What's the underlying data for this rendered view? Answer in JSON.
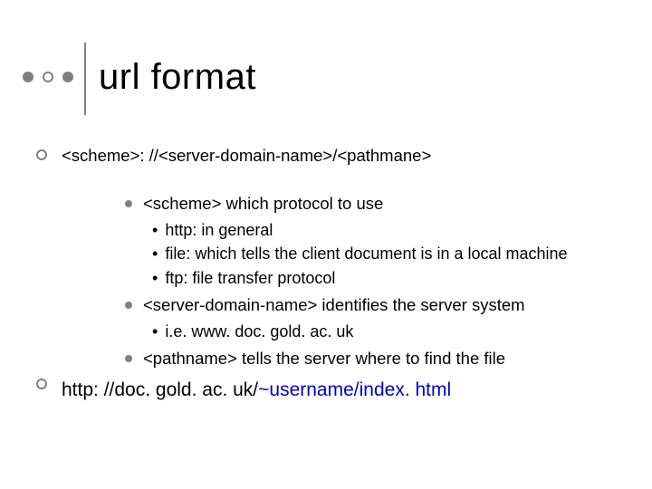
{
  "title": "url format",
  "main_bullet": "<scheme>: //<server-domain-name>/<pathmane>",
  "sections": {
    "scheme": {
      "heading": "<scheme> which protocol to use",
      "items": [
        "http: in general",
        "file: which tells the client document is in a local machine",
        "ftp: file transfer protocol"
      ]
    },
    "server": {
      "heading": "<server-domain-name> identifies the server system",
      "items": [
        "i.e. www. doc. gold. ac. uk"
      ]
    },
    "path": {
      "heading": "<pathname> tells the server where to find the file"
    }
  },
  "example_url": {
    "prefix": "http: //doc. gold. ac. uk/",
    "user": "~username/index. html"
  }
}
